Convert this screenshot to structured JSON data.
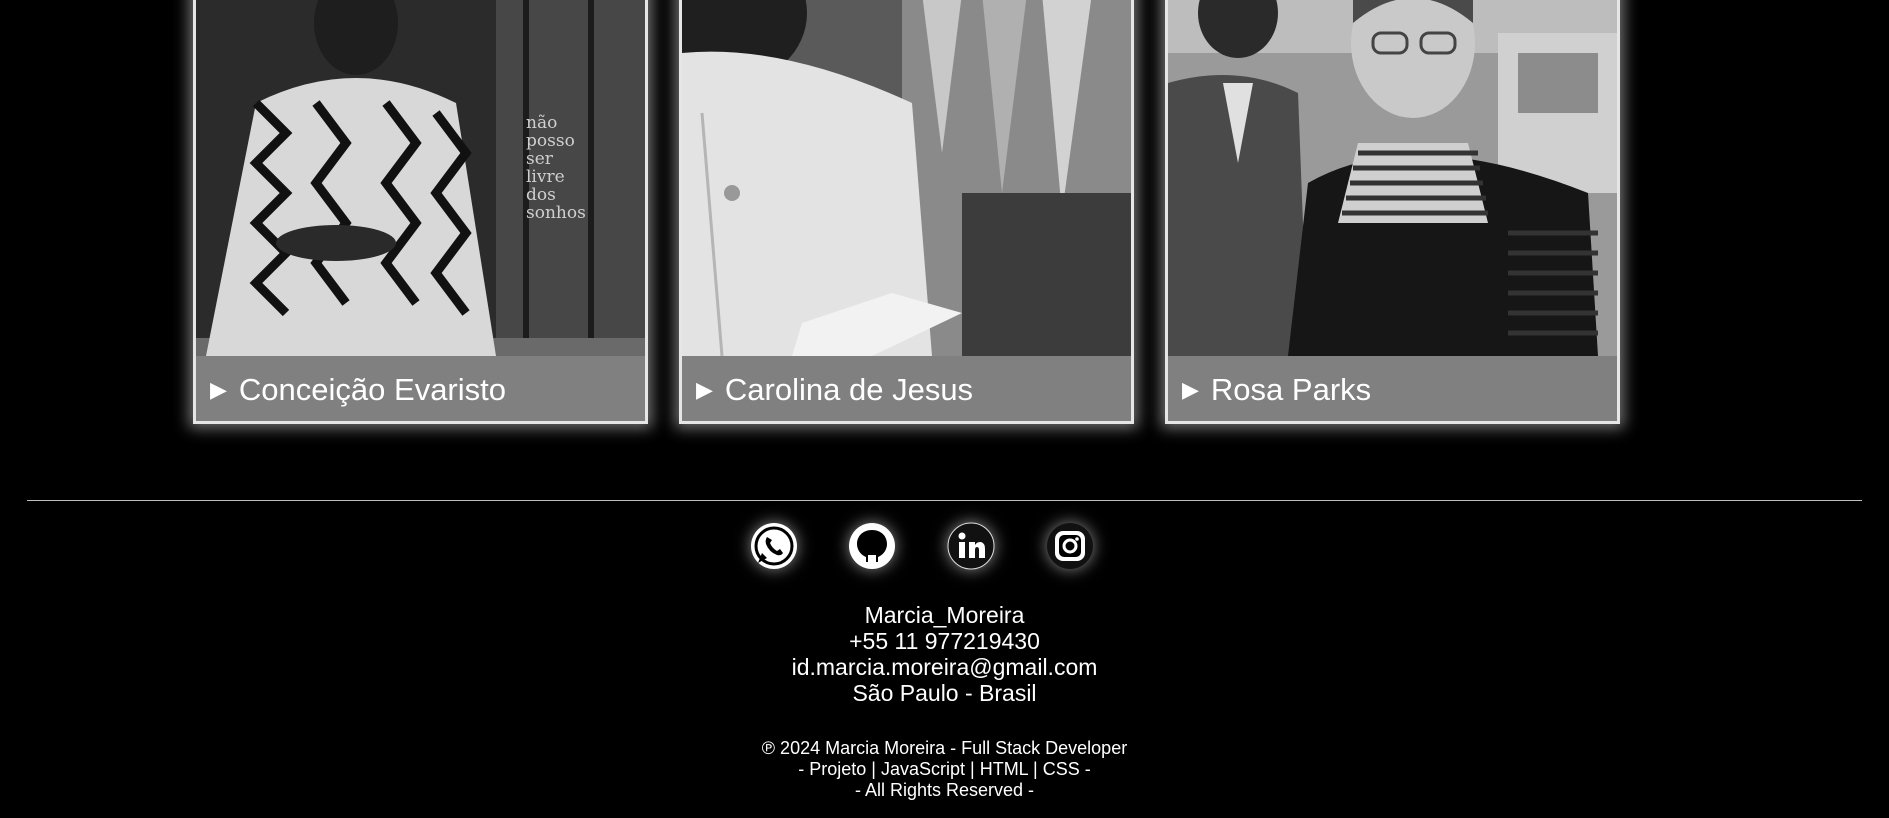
{
  "cards": [
    {
      "label": "Conceição Evaristo",
      "marker": "▶",
      "image": "conceicao-evaristo-photo"
    },
    {
      "label": "Carolina de Jesus",
      "marker": "▶",
      "image": "carolina-de-jesus-photo"
    },
    {
      "label": "Rosa Parks",
      "marker": "▶",
      "image": "rosa-parks-photo"
    }
  ],
  "wall_writing": [
    "não",
    "posso",
    "ser",
    "livre",
    "dos",
    "sonhos"
  ],
  "socials": [
    {
      "icon": "whatsapp-icon"
    },
    {
      "icon": "github-icon"
    },
    {
      "icon": "linkedin-icon"
    },
    {
      "icon": "instagram-icon"
    }
  ],
  "contact": {
    "name": "Marcia_Moreira",
    "phone": "+55 11 977219430",
    "email": "id.marcia.moreira@gmail.com",
    "location": "São Paulo - Brasil"
  },
  "footer": {
    "copyright": "℗ 2024 Marcia Moreira - Full Stack Developer",
    "stack": "- Projeto | JavaScript | HTML | CSS -",
    "rights": "- All Rights Reserved -"
  },
  "colors": {
    "background": "#000000",
    "card_border": "#e6e6e6",
    "summary_bg": "#808080",
    "text": "#ffffff"
  }
}
